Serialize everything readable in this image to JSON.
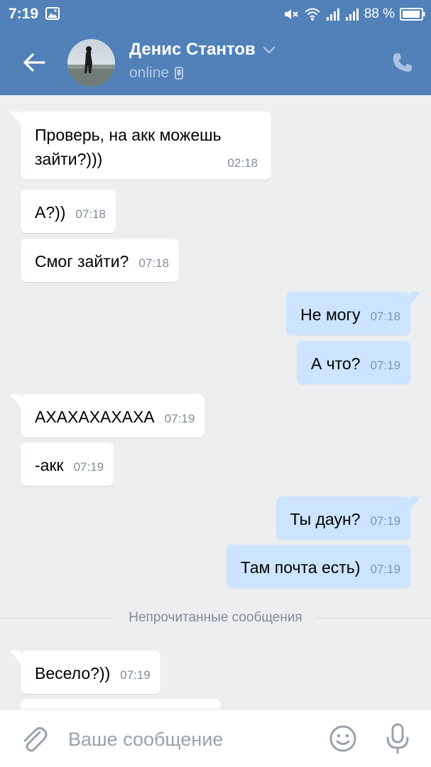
{
  "status_bar": {
    "time": "7:19",
    "battery": "88 %"
  },
  "header": {
    "contact_name": "Денис Стантов",
    "presence": "online"
  },
  "messages": [
    {
      "dir": "in",
      "text": "Проверь, на акк можешь зайти?)))",
      "time": "02:18"
    },
    {
      "dir": "in",
      "text": "А?))",
      "time": "07:18"
    },
    {
      "dir": "in",
      "text": "Смог зайти?",
      "time": "07:18"
    },
    {
      "dir": "out",
      "text": "Не могу",
      "time": "07:18"
    },
    {
      "dir": "out",
      "text": "А что?",
      "time": "07:19"
    },
    {
      "dir": "in",
      "text": "АХАХАХАХАХА",
      "time": "07:19"
    },
    {
      "dir": "in",
      "text": "-акк",
      "time": "07:19"
    },
    {
      "dir": "out",
      "text": "Ты даун?",
      "time": "07:19"
    },
    {
      "dir": "out",
      "text": "Там почта есть)",
      "time": "07:19"
    },
    {
      "dir": "in",
      "text": "Весело?))",
      "time": "07:19"
    }
  ],
  "unread_divider": "Непрочитанные сообщения",
  "composer": {
    "placeholder": "Ваше сообщение"
  },
  "colors": {
    "header_bg": "#5181b8",
    "chat_bg": "#edeef0",
    "incoming_bubble": "#ffffff",
    "outgoing_bubble": "#cce4ff",
    "timestamp": "#818c99"
  }
}
